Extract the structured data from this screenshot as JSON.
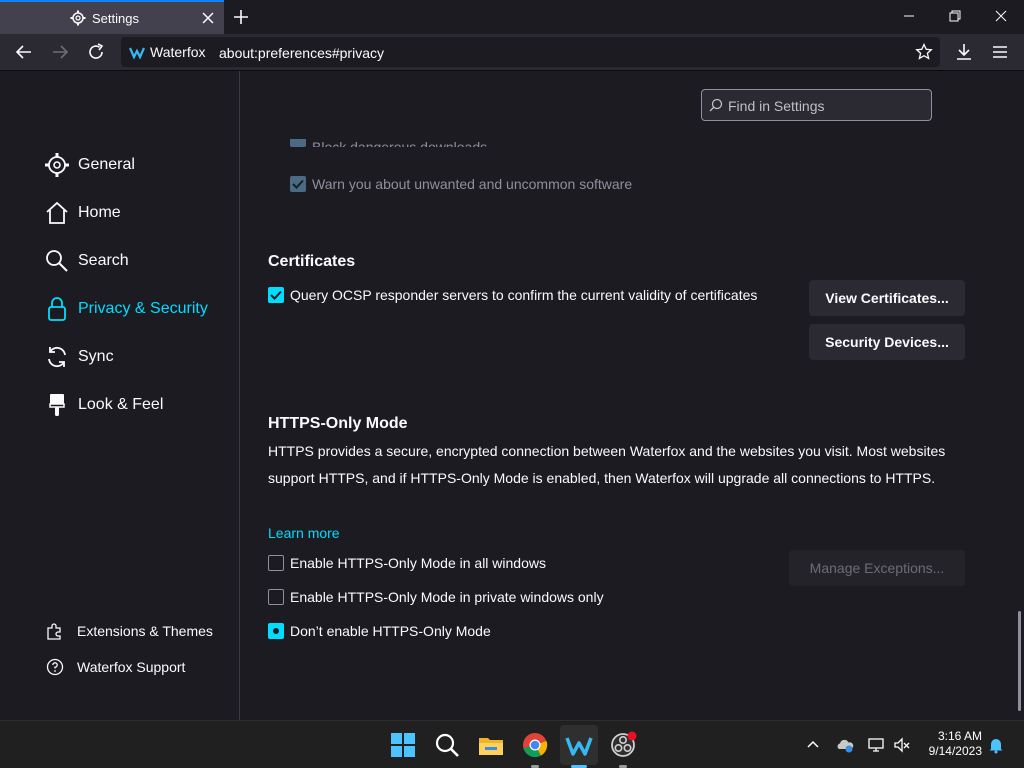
{
  "tab": {
    "title": "Settings"
  },
  "url": {
    "identity": "Waterfox",
    "address": "about:preferences#privacy"
  },
  "sidebar": {
    "categories": [
      {
        "label": "General"
      },
      {
        "label": "Home"
      },
      {
        "label": "Search"
      },
      {
        "label": "Privacy & Security",
        "selected": true
      },
      {
        "label": "Sync"
      },
      {
        "label": "Look & Feel"
      }
    ],
    "footer": [
      {
        "label": "Extensions & Themes"
      },
      {
        "label": "Waterfox Support"
      }
    ]
  },
  "search": {
    "placeholder": "Find in Settings"
  },
  "security": {
    "partial_label": "Block dangerous downloads",
    "warn_label": "Warn you about unwanted and uncommon software"
  },
  "certificates": {
    "heading": "Certificates",
    "ocsp_label": "Query OCSP responder servers to confirm the current validity of certificates",
    "view_button": "View Certificates...",
    "devices_button": "Security Devices..."
  },
  "https": {
    "heading": "HTTPS-Only Mode",
    "description": "HTTPS provides a secure, encrypted connection between Waterfox and the websites you visit. Most websites support HTTPS, and if HTTPS-Only Mode is enabled, then Waterfox will upgrade all connections to HTTPS.",
    "learn_more": "Learn more",
    "options": [
      {
        "label": "Enable HTTPS-Only Mode in all windows",
        "selected": false
      },
      {
        "label": "Enable HTTPS-Only Mode in private windows only",
        "selected": false
      },
      {
        "label": "Don’t enable HTTPS-Only Mode",
        "selected": true
      }
    ],
    "exceptions_button": "Manage Exceptions..."
  },
  "taskbar": {
    "time": "3:16 AM",
    "date": "9/14/2023"
  },
  "colors": {
    "accent": "#00ddff",
    "background": "#1c1b22",
    "toolbar": "#2b2a33"
  }
}
